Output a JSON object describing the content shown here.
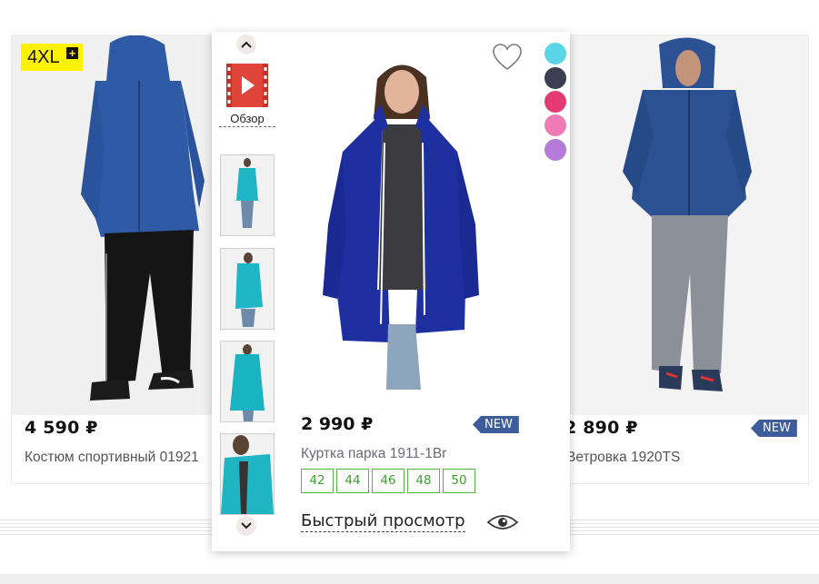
{
  "products": {
    "left": {
      "badge": "4XL",
      "badge_plus": "+",
      "price": "4 590 ₽",
      "name": "Костюм спортивный 01921",
      "accent": "#fff200"
    },
    "right": {
      "price": "2 890 ₽",
      "name": "Ветровка 1920TS",
      "badge": "NEW"
    }
  },
  "quickview": {
    "video_label": "Обзор",
    "price": "2 990 ₽",
    "badge": "NEW",
    "name": "Куртка парка 1911-1Br",
    "sizes": [
      "42",
      "44",
      "46",
      "48",
      "50"
    ],
    "quick_view_label": "Быстрый просмотр",
    "colors": [
      "#5bd6e6",
      "#3c3e52",
      "#e33a73",
      "#f07bb4",
      "#b57bd6"
    ],
    "icons": [
      "chevron-up-icon",
      "video-play-icon",
      "heart-icon",
      "chevron-down-icon",
      "eye-icon"
    ]
  },
  "colors": {
    "new_badge": "#3d5d9a",
    "size_border": "#58b34a"
  }
}
